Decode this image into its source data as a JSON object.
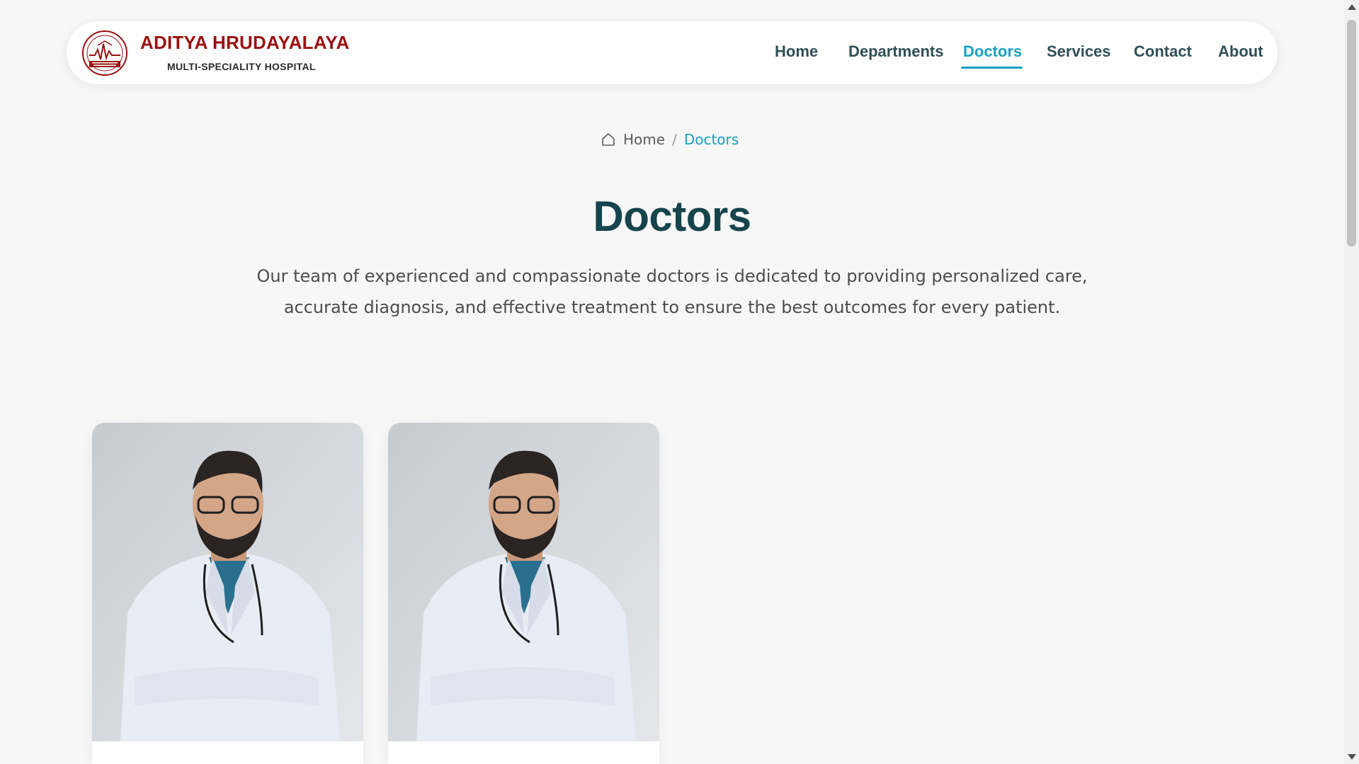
{
  "header": {
    "brand_name": "ADITYA HRUDAYALAYA",
    "brand_subtitle": "MULTI-SPECIALITY HOSPITAL",
    "logo_icon": "hospital-seal-logo",
    "nav": [
      {
        "label": "Home",
        "active": false
      },
      {
        "label": "Departments",
        "active": false
      },
      {
        "label": "Doctors",
        "active": true
      },
      {
        "label": "Services",
        "active": false
      },
      {
        "label": "Contact",
        "active": false
      },
      {
        "label": "About",
        "active": false
      }
    ]
  },
  "breadcrumb": {
    "home_icon": "home-icon",
    "home_label": "Home",
    "separator": "/",
    "current": "Doctors"
  },
  "main": {
    "title": "Doctors",
    "intro_line1": "Our team of experienced and compassionate doctors is dedicated to providing personalized care,",
    "intro_line2": "accurate diagnosis, and effective treatment to ensure the best outcomes for every patient."
  },
  "doctors": [
    {
      "photo_icon": "doctor-photo"
    },
    {
      "photo_icon": "doctor-photo"
    }
  ],
  "colors": {
    "brand_red": "#9b1111",
    "accent_teal": "#1aa0c0",
    "title_dark": "#16444c",
    "nav_text": "#2f4f56",
    "background": "#f7f7f7"
  }
}
